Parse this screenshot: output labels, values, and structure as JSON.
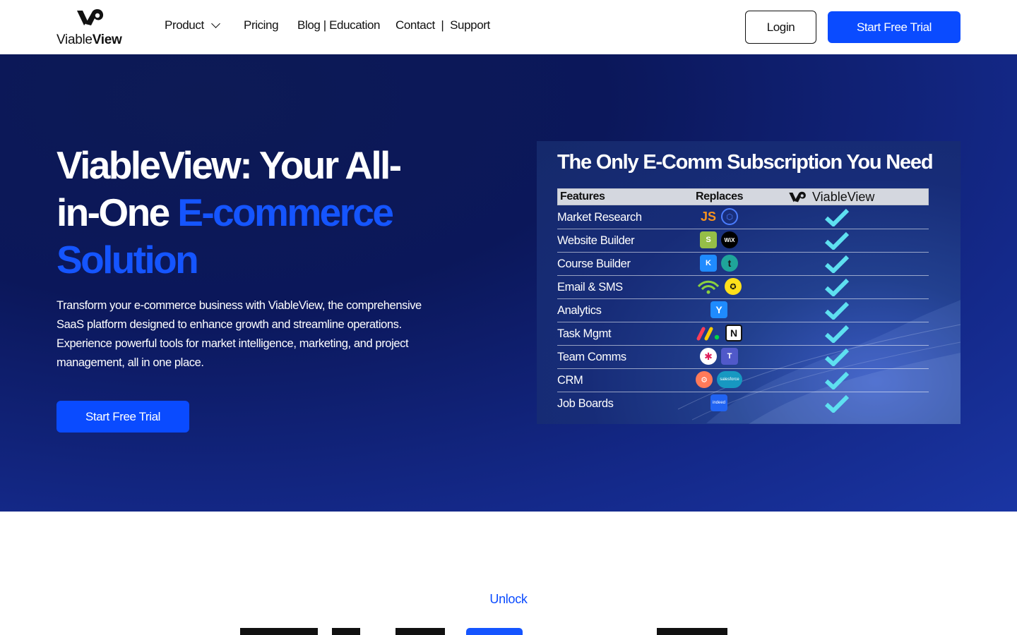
{
  "nav": {
    "logo_text_light": "Viable",
    "logo_text_bold": "View",
    "menu": [
      "Product",
      "Pricing",
      "Blog | Education",
      "Contact  |  Support"
    ],
    "login_label": "Login",
    "trial_label": "Start Free Trial"
  },
  "hero": {
    "title_line1": "ViableView: Your All-",
    "title_line2_plain": "in-One ",
    "title_line2_accent": "E-commerce",
    "title_line3_accent": "Solution",
    "description": "Transform your e-commerce business with ViableView, the comprehensive SaaS platform designed to enhance growth and streamline operations. Experience powerful tools for market intelligence, marketing, and project management, all in one place.",
    "cta_label": "Start Free Trial",
    "accent_color": "#1555ff"
  },
  "comparison": {
    "title": "The Only E-Comm Subscription You Need",
    "headers": {
      "features": "Features",
      "replaces": "Replaces",
      "brand": "ViableView"
    },
    "rows": [
      {
        "feature": "Market Research",
        "icons": [
          "jungle-scout-icon",
          "helium10-icon"
        ]
      },
      {
        "feature": "Website Builder",
        "icons": [
          "shopify-icon",
          "wix-icon"
        ]
      },
      {
        "feature": "Course Builder",
        "icons": [
          "kajabi-icon",
          "teachable-icon"
        ]
      },
      {
        "feature": "Email & SMS",
        "icons": [
          "klaviyo-icon",
          "mailchimp-icon"
        ]
      },
      {
        "feature": "Analytics",
        "icons": [
          "triple-whale-icon"
        ]
      },
      {
        "feature": "Task Mgmt",
        "icons": [
          "monday-icon",
          "notion-icon"
        ]
      },
      {
        "feature": "Team Comms",
        "icons": [
          "slack-icon",
          "teams-icon"
        ]
      },
      {
        "feature": "CRM",
        "icons": [
          "hubspot-icon",
          "salesforce-icon"
        ]
      },
      {
        "feature": "Job Boards",
        "icons": [
          "indeed-icon"
        ]
      }
    ],
    "check_color": "#5ee0f0"
  },
  "next_section": {
    "eyebrow": "Unlock"
  }
}
